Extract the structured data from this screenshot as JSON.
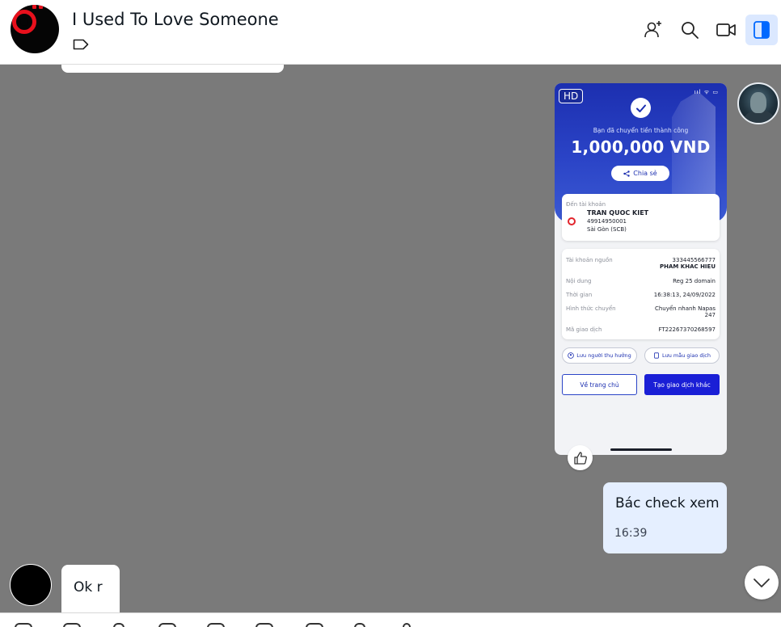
{
  "header": {
    "title": "I Used To Love Someone",
    "icons": [
      "add-member-icon",
      "search-icon",
      "video-call-icon",
      "sidebar-toggle-icon"
    ]
  },
  "image_message": {
    "hd_badge": "HD",
    "status_bar": "ııl ᯤ ▭",
    "success_text": "Bạn đã chuyển tiền thành công",
    "amount": "1,000,000 VND",
    "share_label": "Chia sẻ",
    "to_account_label": "Đến tài khoản",
    "recipient_name": "TRAN QUOC KIET",
    "recipient_account": "49914950001",
    "recipient_bank": "Sài Gòn (SCB)",
    "details": [
      {
        "label": "Tài khoản nguồn",
        "value": "333445566777",
        "value2": "PHAM KHAC HIEU"
      },
      {
        "label": "Nội dung",
        "value": "Reg 25 domain",
        "value2": ""
      },
      {
        "label": "Thời gian",
        "value": "16:38:13, 24/09/2022",
        "value2": ""
      },
      {
        "label": "Hình thức chuyển",
        "value": "Chuyển nhanh Napas",
        "value2": "247"
      },
      {
        "label": "Mã giao dịch",
        "value": "FT22267370268597",
        "value2": ""
      }
    ],
    "save_recipient": "Lưu người thụ hưởng",
    "save_template": "Lưu mẫu giao dịch",
    "home_button": "Về trang chủ",
    "new_transaction_button": "Tạo giao dịch khác"
  },
  "my_message": {
    "text": "Bác check xem",
    "time": "16:39"
  },
  "reply_message": {
    "text": "Ok r"
  },
  "colors": {
    "chat_background": "#7a7a7a",
    "my_bubble": "#e5efff",
    "brand_blue": "#1c2fb0",
    "active_icon_bg": "#dbe8ff"
  }
}
